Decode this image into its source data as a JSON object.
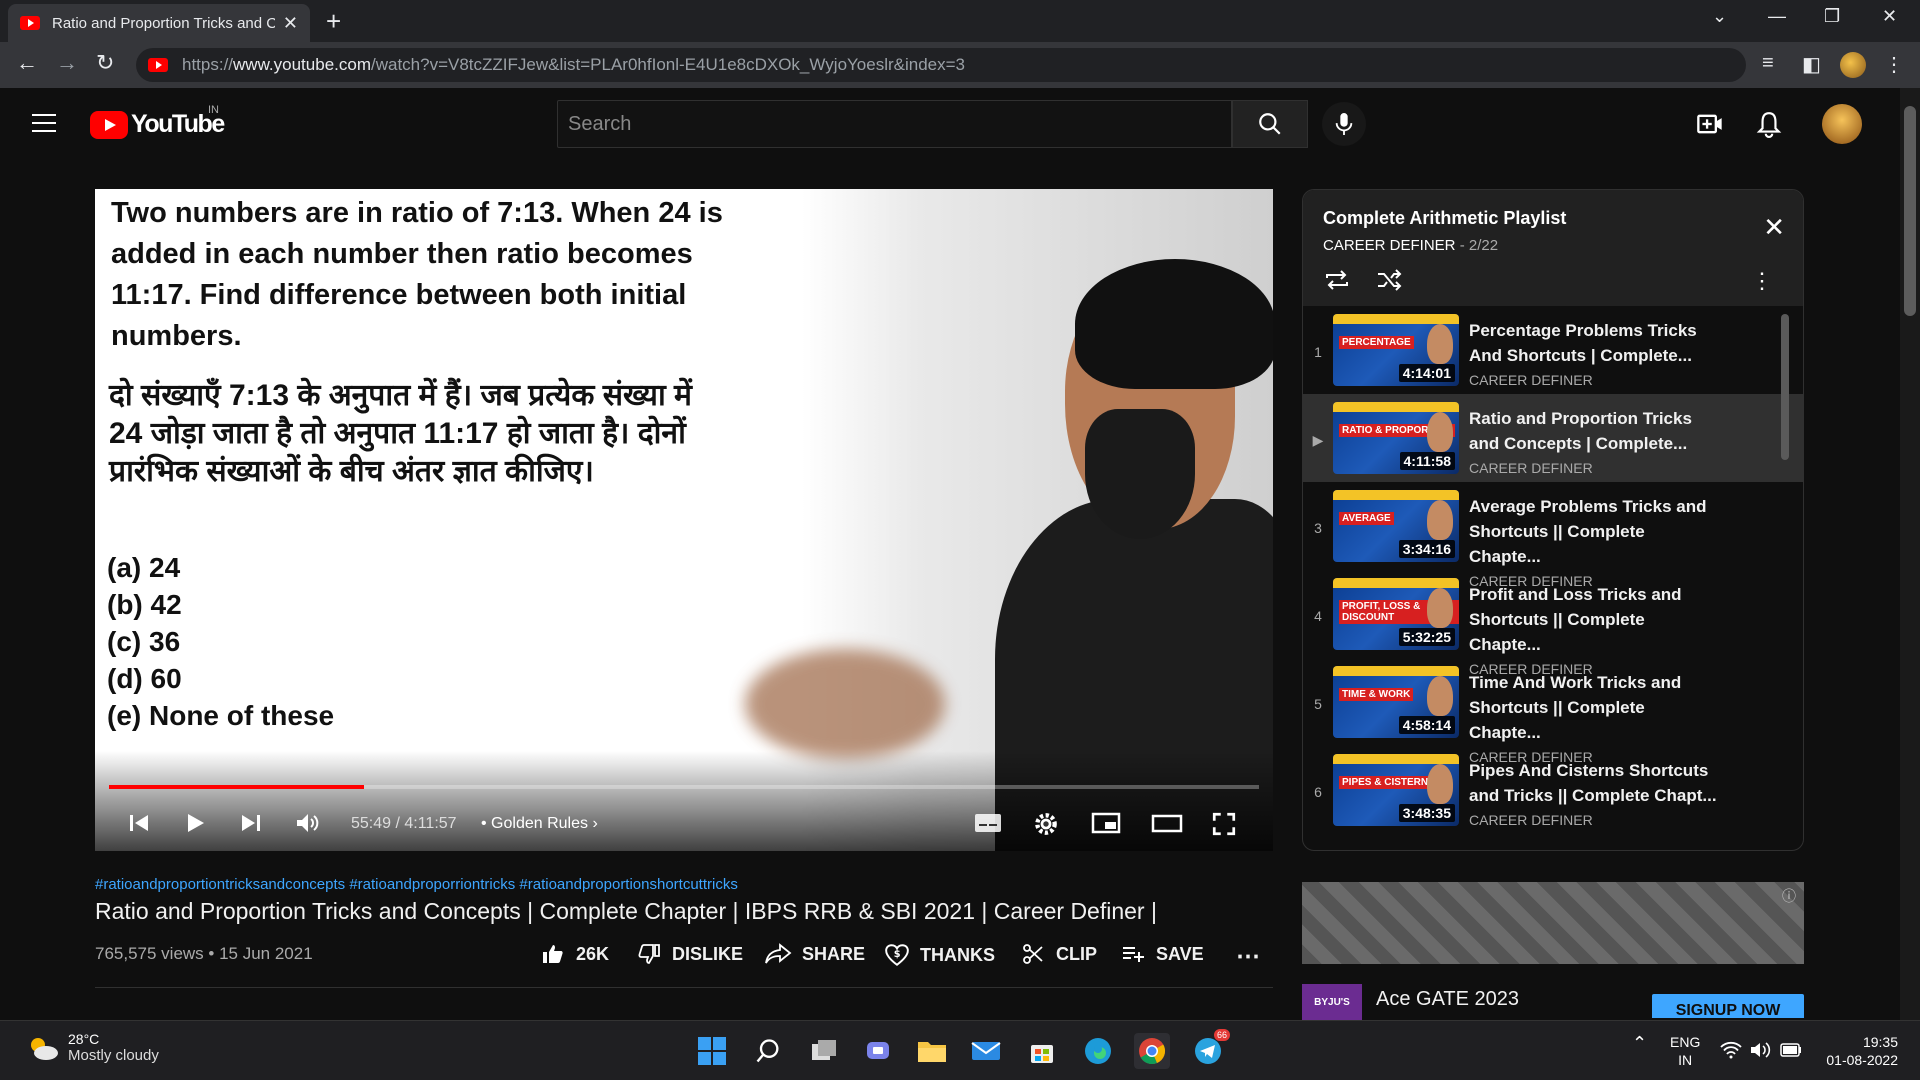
{
  "browser": {
    "tab_title": "Ratio and Proportion Tricks and C",
    "url_prefix": "https://",
    "url_domain": "www.youtube.com",
    "url_path": "/watch?v=V8tcZZIFJew&list=PLAr0hfIonl-E4U1e8cDXOk_WyjoYoeslr&index=3"
  },
  "youtube": {
    "logo_text": "YouTube",
    "country": "IN",
    "search_placeholder": "Search"
  },
  "video": {
    "question_en": "Two numbers are in ratio of 7:13. When 24 is added in each number then ratio becomes 11:17. Find difference between both initial numbers.",
    "question_hi": "दो संख्याएँ 7:13 के अनुपात में हैं। जब प्रत्येक संख्या में 24 जोड़ा जाता है तो अनुपात 11:17 हो जाता है। दोनों प्रारंभिक संख्याओं के बीच अंतर ज्ञात कीजिए।",
    "options": [
      "(a) 24",
      "(b) 42",
      "(c) 36",
      "(d) 60",
      "(e) None of these"
    ],
    "time_display": "55:49 / 4:11:57",
    "chapter": "• Golden Rules",
    "progress_fraction": 0.222
  },
  "info": {
    "hashtags": "#ratioandproportiontricksandconcepts #ratioandproporriontricks #ratioandproportionshortcuttricks",
    "title": "Ratio and Proportion Tricks and Concepts | Complete Chapter | IBPS RRB & SBI 2021 | Career Definer |",
    "views_date": "765,575 views • 15 Jun 2021",
    "likes": "26K",
    "dislike": "DISLIKE",
    "share": "SHARE",
    "thanks": "THANKS",
    "clip": "CLIP",
    "save": "SAVE"
  },
  "playlist": {
    "title": "Complete Arithmetic Playlist",
    "channel": "CAREER DEFINER",
    "position": " - 2/22",
    "items": [
      {
        "index": "1",
        "title": "Percentage Problems Tricks And Shortcuts | Complete...",
        "channel": "CAREER DEFINER",
        "duration": "4:14:01",
        "badge": "PERCENTAGE"
      },
      {
        "index": "▶",
        "title": "Ratio and Proportion Tricks and Concepts | Complete...",
        "channel": "CAREER DEFINER",
        "duration": "4:11:58",
        "badge": "RATIO & PROPORTION"
      },
      {
        "index": "3",
        "title": "Average Problems Tricks and Shortcuts || Complete Chapte...",
        "channel": "CAREER DEFINER",
        "duration": "3:34:16",
        "badge": "AVERAGE"
      },
      {
        "index": "4",
        "title": "Profit and Loss Tricks and Shortcuts || Complete Chapte...",
        "channel": "CAREER DEFINER",
        "duration": "5:32:25",
        "badge": "PROFIT, LOSS & DISCOUNT"
      },
      {
        "index": "5",
        "title": "Time And Work Tricks and Shortcuts || Complete Chapte...",
        "channel": "CAREER DEFINER",
        "duration": "4:58:14",
        "badge": "TIME & WORK"
      },
      {
        "index": "6",
        "title": "Pipes And Cisterns Shortcuts and Tricks || Complete Chapt...",
        "channel": "CAREER DEFINER",
        "duration": "3:48:35",
        "badge": "PIPES & CISTERNS"
      }
    ]
  },
  "ad": {
    "title": "Ace GATE 2023",
    "logo": "BYJU'S",
    "cta": "SIGNUP NOW"
  },
  "taskbar": {
    "temp": "28°C",
    "weather": "Mostly cloudy",
    "lang": "ENG",
    "region": "IN",
    "time": "19:35",
    "date": "01-08-2022",
    "telegram_badge": "66"
  }
}
